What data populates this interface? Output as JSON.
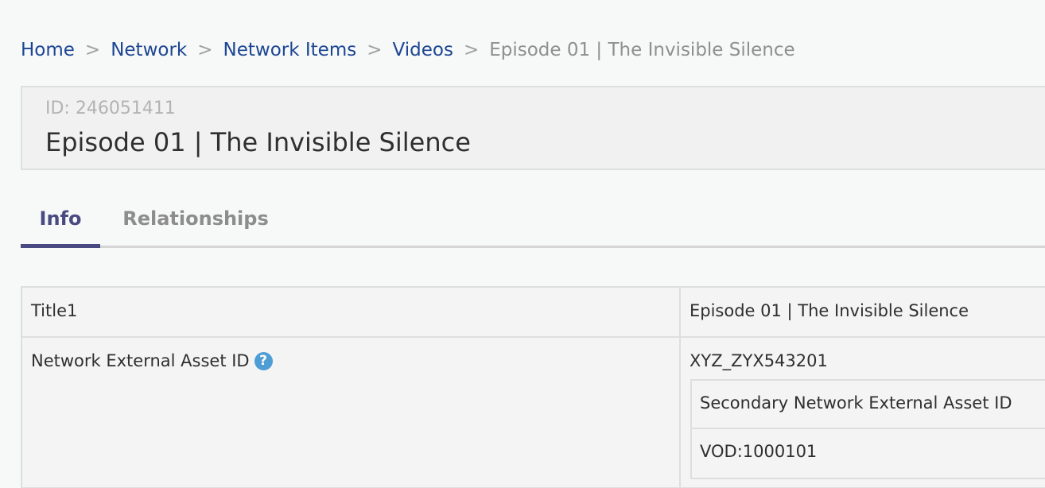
{
  "breadcrumb": {
    "items": [
      {
        "label": "Home"
      },
      {
        "label": "Network"
      },
      {
        "label": "Network Items"
      },
      {
        "label": "Videos"
      }
    ],
    "separator": ">",
    "current": "Episode 01 | The Invisible Silence"
  },
  "record": {
    "id_label": "ID: 246051411",
    "title": "Episode 01 | The Invisible Silence"
  },
  "tabs": [
    {
      "label": "Info",
      "active": true
    },
    {
      "label": "Relationships",
      "active": false
    }
  ],
  "info_table": {
    "rows": [
      {
        "label": "Title1",
        "value": "Episode 01 | The Invisible Silence"
      },
      {
        "label": "Network External Asset ID",
        "help_icon": "question-circle-icon",
        "value": "XYZ_ZYX543201",
        "nested": {
          "header": "Secondary Network External Asset ID",
          "value": "VOD:1000101"
        }
      }
    ]
  },
  "colors": {
    "link": "#1c4693",
    "active_tab": "#4a4a82",
    "help_icon": "#4e9ed5",
    "muted_text": "#8f8f8f"
  }
}
